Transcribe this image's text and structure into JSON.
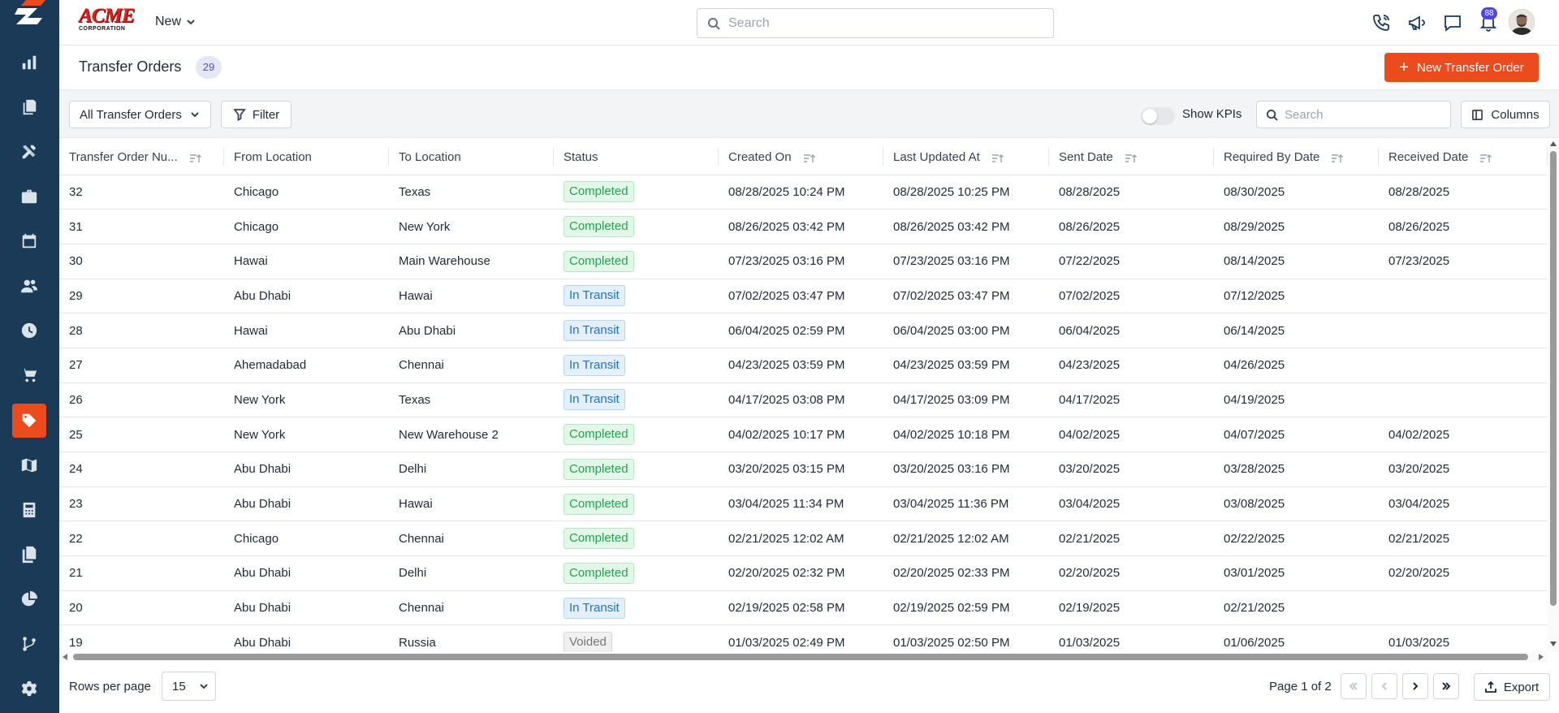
{
  "brand": {
    "name": "ACME",
    "subtitle": "CORPORATION",
    "accent": "#ec4b1e",
    "sidebar_bg": "#1b3a57"
  },
  "sidebar": {
    "items": [
      {
        "icon": "bar-chart-icon",
        "active": false
      },
      {
        "icon": "documents-icon",
        "active": false
      },
      {
        "icon": "tools-icon",
        "active": false
      },
      {
        "icon": "briefcase-icon",
        "active": false
      },
      {
        "icon": "calendar-icon",
        "active": false
      },
      {
        "icon": "users-icon",
        "active": false
      },
      {
        "icon": "clock-icon",
        "active": false
      },
      {
        "icon": "cart-icon",
        "active": false
      },
      {
        "icon": "tag-icon",
        "active": true
      },
      {
        "icon": "map-icon",
        "active": false
      },
      {
        "icon": "calculator-icon",
        "active": false
      },
      {
        "icon": "files-icon",
        "active": false
      },
      {
        "icon": "pie-chart-icon",
        "active": false
      },
      {
        "icon": "branch-icon",
        "active": false
      },
      {
        "icon": "settings-icon",
        "active": false
      }
    ]
  },
  "topbar": {
    "new_label": "New",
    "search_placeholder": "Search",
    "notification_count": "88",
    "icons": [
      "phone-icon",
      "megaphone-icon",
      "chat-icon",
      "bell-icon"
    ]
  },
  "page": {
    "title": "Transfer Orders",
    "count": "29",
    "new_button": "New Transfer Order"
  },
  "toolbar": {
    "view_select": "All Transfer Orders",
    "filter_label": "Filter",
    "kpi_label": "Show KPIs",
    "kpi_on": false,
    "search_placeholder": "Search",
    "columns_label": "Columns"
  },
  "table": {
    "columns": [
      {
        "label": "Transfer Order Nu...",
        "sortable": true
      },
      {
        "label": "From Location",
        "sortable": false
      },
      {
        "label": "To Location",
        "sortable": false
      },
      {
        "label": "Status",
        "sortable": false
      },
      {
        "label": "Created On",
        "sortable": true
      },
      {
        "label": "Last Updated At",
        "sortable": true
      },
      {
        "label": "Sent Date",
        "sortable": true
      },
      {
        "label": "Required By Date",
        "sortable": true
      },
      {
        "label": "Received Date",
        "sortable": true
      }
    ],
    "rows": [
      {
        "num": "32",
        "from": "Chicago",
        "to": "Texas",
        "status": "Completed",
        "created": "08/28/2025 10:24 PM",
        "updated": "08/28/2025 10:25 PM",
        "sent": "08/28/2025",
        "required": "08/30/2025",
        "received": "08/28/2025"
      },
      {
        "num": "31",
        "from": "Chicago",
        "to": "New York",
        "status": "Completed",
        "created": "08/26/2025 03:42 PM",
        "updated": "08/26/2025 03:42 PM",
        "sent": "08/26/2025",
        "required": "08/29/2025",
        "received": "08/26/2025"
      },
      {
        "num": "30",
        "from": "Hawai",
        "to": "Main Warehouse",
        "status": "Completed",
        "created": "07/23/2025 03:16 PM",
        "updated": "07/23/2025 03:16 PM",
        "sent": "07/22/2025",
        "required": "08/14/2025",
        "received": "07/23/2025"
      },
      {
        "num": "29",
        "from": "Abu Dhabi",
        "to": "Hawai",
        "status": "In Transit",
        "created": "07/02/2025 03:47 PM",
        "updated": "07/02/2025 03:47 PM",
        "sent": "07/02/2025",
        "required": "07/12/2025",
        "received": ""
      },
      {
        "num": "28",
        "from": "Hawai",
        "to": "Abu Dhabi",
        "status": "In Transit",
        "created": "06/04/2025 02:59 PM",
        "updated": "06/04/2025 03:00 PM",
        "sent": "06/04/2025",
        "required": "06/14/2025",
        "received": ""
      },
      {
        "num": "27",
        "from": "Ahemadabad",
        "to": "Chennai",
        "status": "In Transit",
        "created": "04/23/2025 03:59 PM",
        "updated": "04/23/2025 03:59 PM",
        "sent": "04/23/2025",
        "required": "04/26/2025",
        "received": ""
      },
      {
        "num": "26",
        "from": "New York",
        "to": "Texas",
        "status": "In Transit",
        "created": "04/17/2025 03:08 PM",
        "updated": "04/17/2025 03:09 PM",
        "sent": "04/17/2025",
        "required": "04/19/2025",
        "received": ""
      },
      {
        "num": "25",
        "from": "New York",
        "to": "New Warehouse 2",
        "status": "Completed",
        "created": "04/02/2025 10:17 PM",
        "updated": "04/02/2025 10:18 PM",
        "sent": "04/02/2025",
        "required": "04/07/2025",
        "received": "04/02/2025"
      },
      {
        "num": "24",
        "from": "Abu Dhabi",
        "to": "Delhi",
        "status": "Completed",
        "created": "03/20/2025 03:15 PM",
        "updated": "03/20/2025 03:16 PM",
        "sent": "03/20/2025",
        "required": "03/28/2025",
        "received": "03/20/2025"
      },
      {
        "num": "23",
        "from": "Abu Dhabi",
        "to": "Hawai",
        "status": "Completed",
        "created": "03/04/2025 11:34 PM",
        "updated": "03/04/2025 11:36 PM",
        "sent": "03/04/2025",
        "required": "03/08/2025",
        "received": "03/04/2025"
      },
      {
        "num": "22",
        "from": "Chicago",
        "to": "Chennai",
        "status": "Completed",
        "created": "02/21/2025 12:02 AM",
        "updated": "02/21/2025 12:02 AM",
        "sent": "02/21/2025",
        "required": "02/22/2025",
        "received": "02/21/2025"
      },
      {
        "num": "21",
        "from": "Abu Dhabi",
        "to": "Delhi",
        "status": "Completed",
        "created": "02/20/2025 02:32 PM",
        "updated": "02/20/2025 02:33 PM",
        "sent": "02/20/2025",
        "required": "03/01/2025",
        "received": "02/20/2025"
      },
      {
        "num": "20",
        "from": "Abu Dhabi",
        "to": "Chennai",
        "status": "In Transit",
        "created": "02/19/2025 02:58 PM",
        "updated": "02/19/2025 02:59 PM",
        "sent": "02/19/2025",
        "required": "02/21/2025",
        "received": ""
      },
      {
        "num": "19",
        "from": "Abu Dhabi",
        "to": "Russia",
        "status": "Voided",
        "created": "01/03/2025 02:49 PM",
        "updated": "01/03/2025 02:50 PM",
        "sent": "01/03/2025",
        "required": "01/06/2025",
        "received": "01/03/2025"
      }
    ]
  },
  "footer": {
    "rows_per_page_label": "Rows per page",
    "rows_per_page": "15",
    "page_info": "Page 1 of 2",
    "export_label": "Export"
  }
}
